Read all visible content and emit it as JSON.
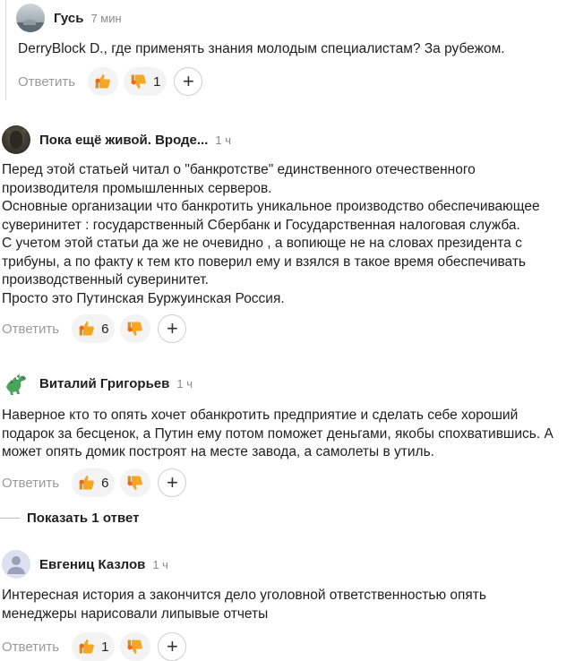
{
  "ui": {
    "reply_label": "Ответить",
    "plus_label": "+",
    "show_replies_label": "Показать 1 ответ"
  },
  "colors": {
    "like": "#f5a623",
    "dislike": "#f5a623",
    "pill_bg": "#f3f3f3",
    "muted": "#9a9a9a"
  },
  "comments": [
    {
      "author": "Гусь",
      "time": "7 мин",
      "avatar": "landscape-avatar",
      "text": "DerryBlock D., где применять знания молодым специалистам? За рубежом.",
      "likes": "",
      "dislikes": "1"
    },
    {
      "author": "Пока ещё живой. Вроде...",
      "time": "1 ч",
      "avatar": "moose-avatar",
      "text": "Перед этой статьей читал о \"банкротстве\" единственного отечественного\nпроизводителя промышленных серверов.\nОсновные организации что банкротить уникальное производство обеспечивающее\nсуверинитет : государственный Сбербанк и Государственная налоговая служба.\nС учетом этой статьи да же не очевидно , а вопиюще не на словах президента с\nтрибуны, а по факту к тем кто поверил ему и взялся в такое время обеспечивать\nпроизводственный суверинитет.\nПросто это Путинская Буржуинская Россия.",
      "likes": "6",
      "dislikes": ""
    },
    {
      "author": "Виталий Григорьев",
      "time": "1 ч",
      "avatar": "dinosaur-avatar",
      "text": "Наверное кто то опять хочет обанкротить предприятие и сделать себе хороший\nподарок за бесценок, а Путин ему потом поможет деньгами, якобы спохватившись. А\nможет опять домик построят на месте завода, а самолеты в утиль.",
      "likes": "6",
      "dislikes": ""
    },
    {
      "author": "Евгениц Казлов",
      "time": "1 ч",
      "avatar": "default-user-avatar",
      "text": "Интересная история а закончится дело уголовной ответственностью опять\nменеджеры нарисовали липывые отчеты",
      "likes": "1",
      "dislikes": ""
    }
  ]
}
